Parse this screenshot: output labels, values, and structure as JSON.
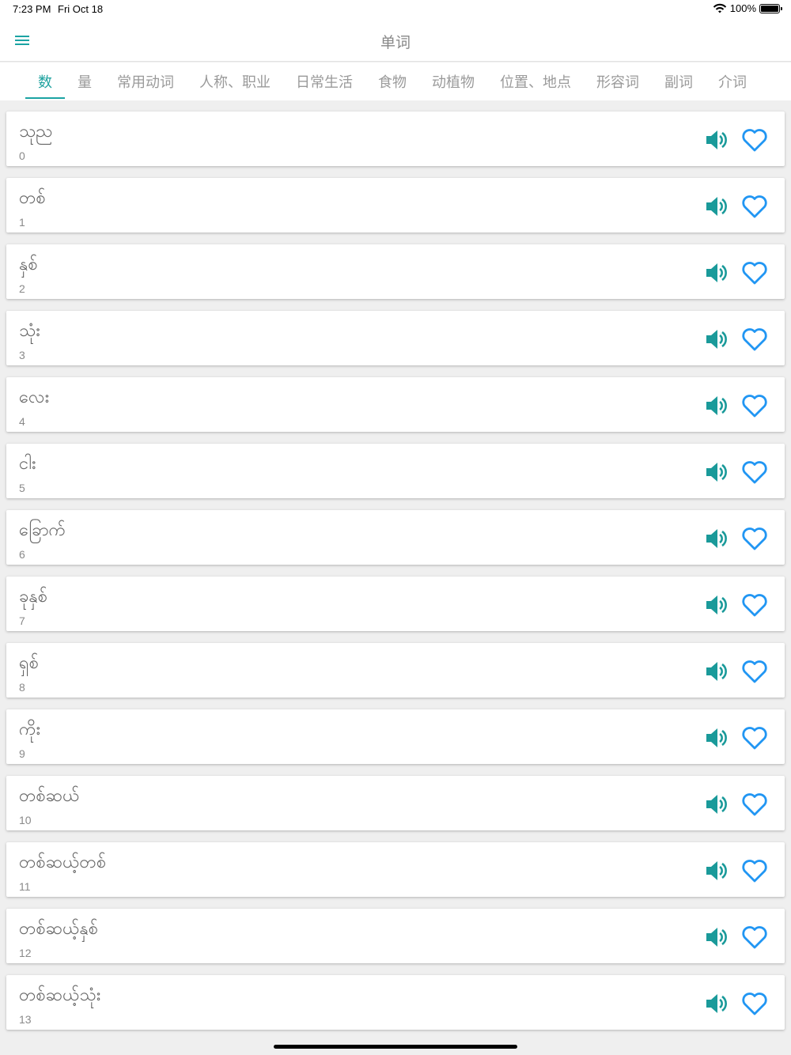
{
  "status_bar": {
    "time": "7:23 PM",
    "date": "Fri Oct 18",
    "battery": "100%"
  },
  "app_bar": {
    "title": "单词",
    "menu_icon": "hamburger-menu-icon"
  },
  "tabs": [
    {
      "label": "数",
      "active": true
    },
    {
      "label": "量",
      "active": false
    },
    {
      "label": "常用动词",
      "active": false
    },
    {
      "label": "人称、职业",
      "active": false
    },
    {
      "label": "日常生活",
      "active": false
    },
    {
      "label": "食物",
      "active": false
    },
    {
      "label": "动植物",
      "active": false
    },
    {
      "label": "位置、地点",
      "active": false
    },
    {
      "label": "形容词",
      "active": false
    },
    {
      "label": "副词",
      "active": false
    },
    {
      "label": "介词",
      "active": false
    }
  ],
  "colors": {
    "accent": "#1ba3a3",
    "heart": "#2196f3",
    "speaker": "#1a9a9a"
  },
  "items": [
    {
      "word": "သုည",
      "number": "0"
    },
    {
      "word": "တစ်",
      "number": "1"
    },
    {
      "word": "နှစ်",
      "number": "2"
    },
    {
      "word": "သုံး",
      "number": "3"
    },
    {
      "word": "လေး",
      "number": "4"
    },
    {
      "word": "ငါး",
      "number": "5"
    },
    {
      "word": "ခြောက်",
      "number": "6"
    },
    {
      "word": "ခုနှစ်",
      "number": "7"
    },
    {
      "word": "ရှစ်",
      "number": "8"
    },
    {
      "word": "ကိုး",
      "number": "9"
    },
    {
      "word": "တစ်ဆယ်",
      "number": "10"
    },
    {
      "word": "တစ်ဆယ့်တစ်",
      "number": "11"
    },
    {
      "word": "တစ်ဆယ့်နှစ်",
      "number": "12"
    },
    {
      "word": "တစ်ဆယ့်သုံး",
      "number": "13"
    }
  ],
  "icons": {
    "speaker": "speaker-icon",
    "favorite": "heart-outline-icon"
  }
}
